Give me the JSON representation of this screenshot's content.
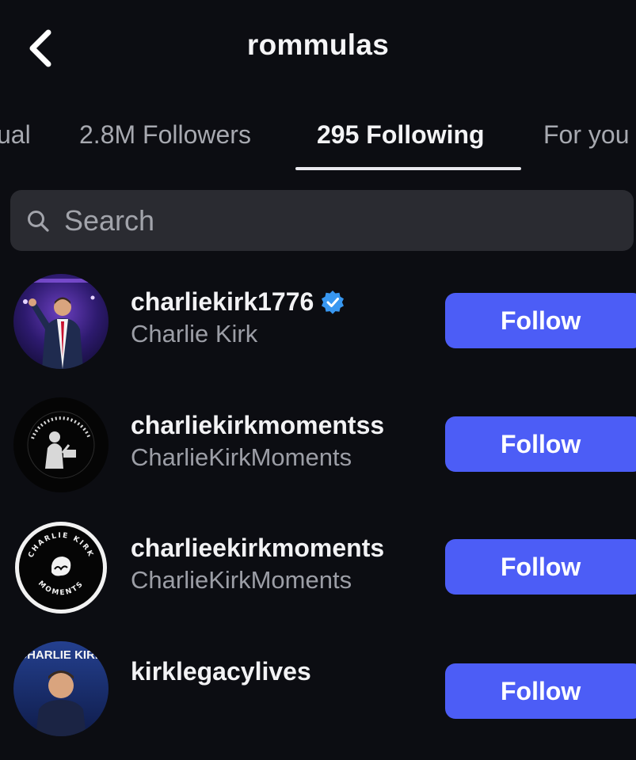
{
  "header": {
    "title": "rommulas"
  },
  "tabs": [
    {
      "label": "ual"
    },
    {
      "label": "2.8M Followers"
    },
    {
      "label": "295 Following"
    },
    {
      "label": "For you"
    }
  ],
  "active_tab": "295 Following",
  "search": {
    "placeholder": "Search",
    "value": ""
  },
  "accounts": [
    {
      "username": "charliekirk1776",
      "full_name": "Charlie Kirk",
      "verified": true,
      "button_label": "Follow"
    },
    {
      "username": "charliekirkmomentss",
      "full_name": "CharlieKirkMoments",
      "verified": false,
      "button_label": "Follow"
    },
    {
      "username": "charlieekirkmoments",
      "full_name": "CharlieKirkMoments",
      "verified": false,
      "button_label": "Follow"
    },
    {
      "username": "kirklegacylives",
      "full_name": "",
      "verified": false,
      "button_label": "Follow"
    }
  ],
  "avatar_text": {
    "moments_ring_top": "CHARLIE KIRK",
    "moments_ring_bottom": "MOMENTS",
    "legacy_banner": "CHARLIE KIRK"
  },
  "colors": {
    "background": "#0c0d12",
    "follow_button": "#4c5df6",
    "search_bg": "#2a2b31",
    "verified_badge": "#3897f0"
  }
}
